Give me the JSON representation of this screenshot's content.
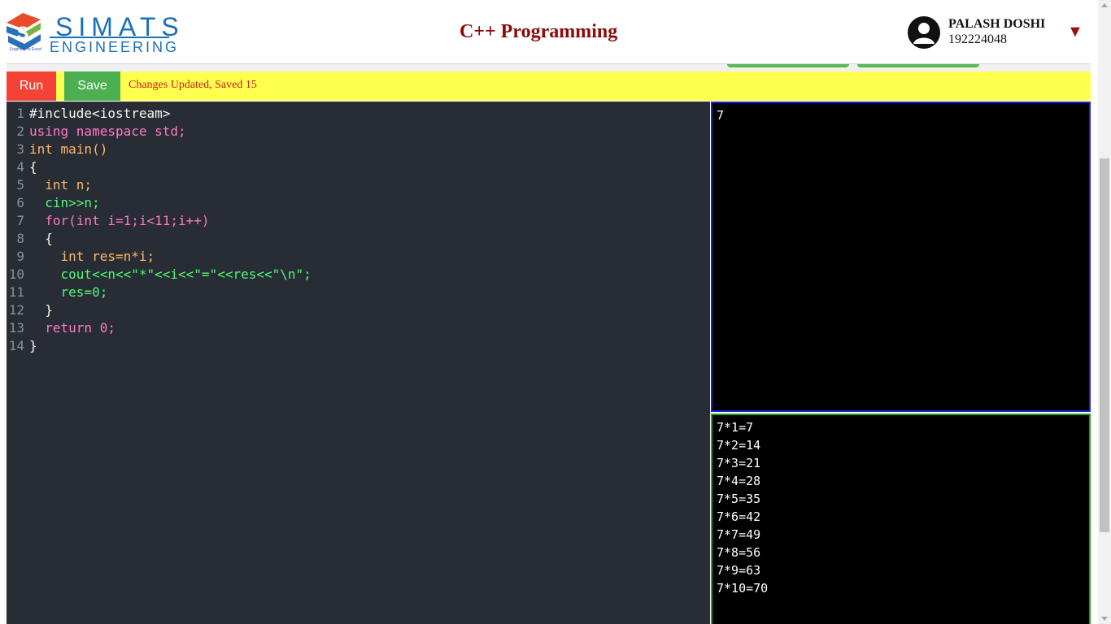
{
  "header": {
    "logo_top": "SIMATS",
    "logo_bottom": "ENGINEERING",
    "logo_tagline": "Engineer to Excel",
    "title": "C++ Programming",
    "user_name": "PALASH DOSHI",
    "user_id": "192224048",
    "dropdown_icon": "▼"
  },
  "toolbar": {
    "run_label": "Run",
    "save_label": "Save",
    "status": "Changes Updated, Saved 15"
  },
  "editor": {
    "line_numbers": [
      "1",
      "2",
      "3",
      "4",
      "5",
      "6",
      "7",
      "8",
      "9",
      "10",
      "11",
      "12",
      "13",
      "14"
    ],
    "lines": [
      "#include<iostream>",
      "using namespace std;",
      "int main()",
      "{",
      "  int n;",
      "  cin>>n;",
      "  for(int i=1;i<11;i++)",
      "  {",
      "    int res=n*i;",
      "    cout<<n<<\"*\"<<i<<\"=\"<<res<<\"\\n\";",
      "    res=0;",
      "  }",
      "  return 0;",
      "}"
    ]
  },
  "input": {
    "value": "7"
  },
  "output": {
    "lines": [
      "7*1=7",
      "7*2=14",
      "7*3=21",
      "7*4=28",
      "7*5=35",
      "7*6=42",
      "7*7=49",
      "7*8=56",
      "7*9=63",
      "7*10=70"
    ]
  },
  "colors": {
    "run": "#f44336",
    "save": "#4caf50",
    "toolbar_bg": "#ffff4f",
    "title": "#8b0a0a",
    "input_border": "#1f1fe0",
    "output_border": "#1fa21f"
  }
}
